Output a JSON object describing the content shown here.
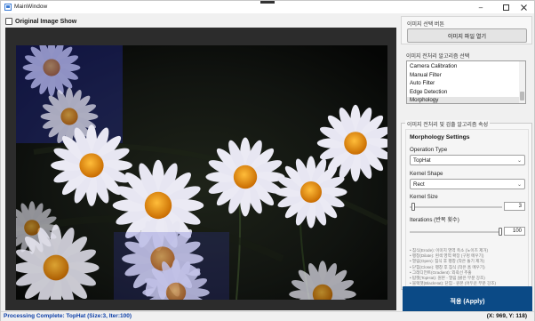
{
  "window": {
    "title": "MainWindow",
    "minimize_icon": "minimize-icon",
    "maximize_icon": "maximize-icon",
    "close_icon": "close-icon"
  },
  "viewer": {
    "show_original_label": "Original Image Show",
    "show_original_checked": false
  },
  "file_group": {
    "title": "이미지 선택 버튼",
    "open_button": "이미지 파일 열기"
  },
  "algo_group": {
    "title": "이미지 전처리 알고리즘 선택",
    "items": [
      "Camera Calibration",
      "Manual Filter",
      "Auto Filter",
      "Edge Detection",
      "Morphology"
    ],
    "selected_index": 4
  },
  "props": {
    "legend": "이미지 전처리 및 검출 알고리즘 속성",
    "heading": "Morphology Settings",
    "operation_label": "Operation Type",
    "operation_value": "TopHat",
    "kernel_shape_label": "Kernel Shape",
    "kernel_shape_value": "Rect",
    "kernel_size_label": "Kernel Size",
    "kernel_size_value": "3",
    "iterations_label": "Iterations (반복 횟수)",
    "iterations_value": "100",
    "help": [
      "• 침식(Erode): 이미지 영역 축소 (노이즈 제거)",
      "• 팽창(Dilate): 흰색 영역 확장 (구멍 메우기)",
      "• 열림(Open): 침식 후 팽창 (작은 돌기 제거)",
      "• 닫힘(Close): 팽창 후 침식 (작은 홈 메우기)",
      "• 그래디언트(Gradient): 외곽선 추출",
      "• 탑햇(TopHat): 원본 - 열림 (밝은 부분 강조)",
      "• 블랙햇(BlackHat): 닫힘 - 원본 (어두운 부분 강조)"
    ]
  },
  "apply_button": "적용 (Apply)",
  "status": {
    "message": "Processing Complete: TopHat (Size:3, Iter:100)",
    "coords": "(X: 969, Y: 118)"
  },
  "colors": {
    "accent": "#0b4a86",
    "status_text": "#0b3ea8"
  }
}
